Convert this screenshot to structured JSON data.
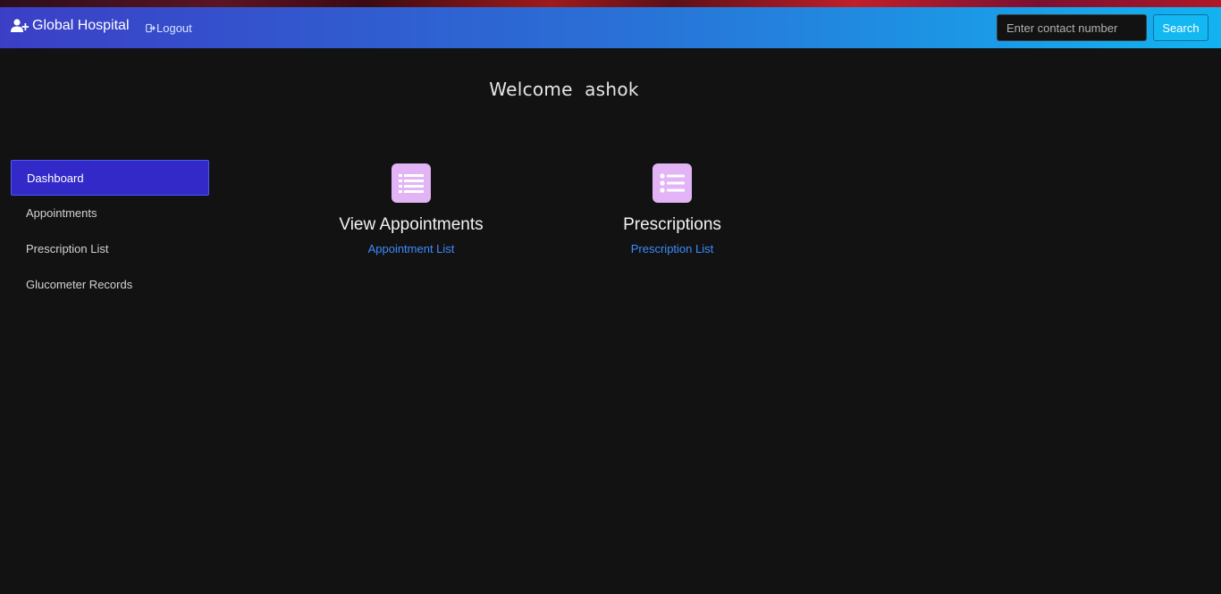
{
  "navbar": {
    "brand": "Global Hospital",
    "logout_label": "Logout",
    "search_placeholder": "Enter contact number",
    "search_button": "Search",
    "gradient_start": "#3b3fc6",
    "gradient_end": "#12b3f0"
  },
  "welcome": {
    "text": "Welcome  ashok"
  },
  "sidebar": {
    "items": [
      {
        "label": "Dashboard",
        "active": true
      },
      {
        "label": "Appointments",
        "active": false
      },
      {
        "label": "Prescription List",
        "active": false
      },
      {
        "label": "Glucometer Records",
        "active": false
      }
    ],
    "active_color": "#3328c8"
  },
  "cards": [
    {
      "icon": "list-icon",
      "title": "View Appointments",
      "link": "Appointment List"
    },
    {
      "icon": "list-ul-icon",
      "title": "Prescriptions",
      "link": "Prescription List"
    }
  ],
  "colors": {
    "background": "#121212",
    "link": "#3d8bfd",
    "card_icon_bg": "#e2b4f6"
  }
}
